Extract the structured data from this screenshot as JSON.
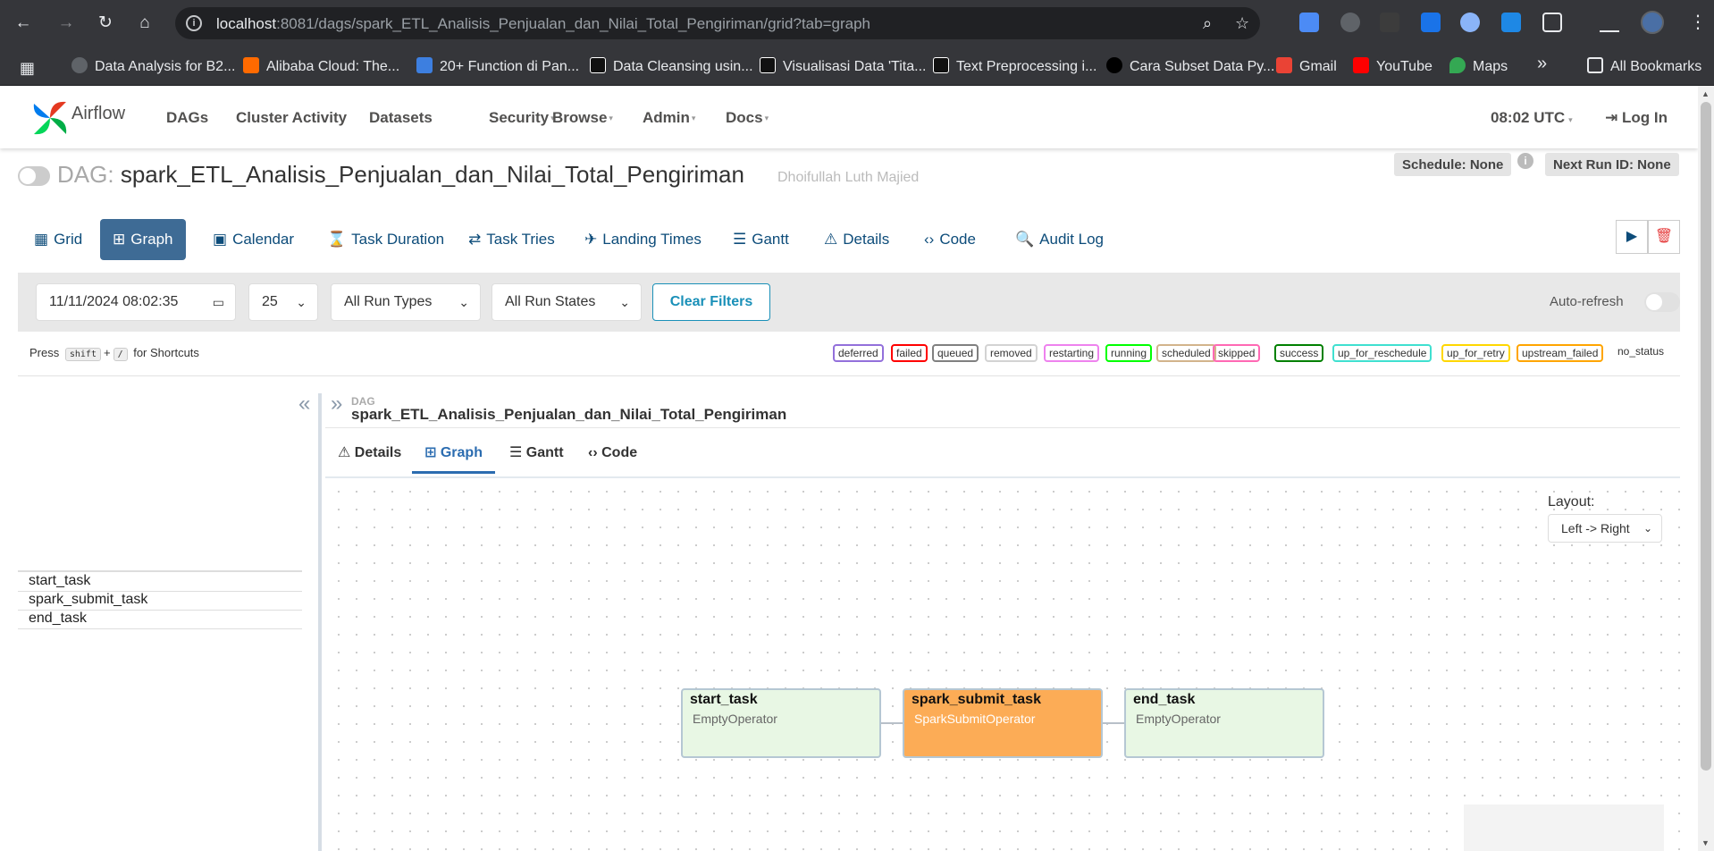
{
  "browser": {
    "url_host": "localhost",
    "url_rest": ":8081/dags/spark_ETL_Analisis_Penjualan_dan_Nilai_Total_Pengiriman/grid?tab=graph",
    "bookmarks": [
      "Data Analysis for B2...",
      "Alibaba Cloud: The...",
      "20+ Function di Pan...",
      "Data Cleansing usin...",
      "Visualisasi Data 'Tita...",
      "Text Preprocessing i...",
      "Cara Subset Data Py...",
      "Gmail",
      "YouTube",
      "Maps"
    ],
    "overflow": "»",
    "all_bookmarks": "All Bookmarks"
  },
  "navbar": {
    "brand": "Airflow",
    "menu": [
      "DAGs",
      "Cluster Activity",
      "Datasets",
      "Security",
      "Browse",
      "Admin",
      "Docs"
    ],
    "time": "08:02 UTC",
    "login": "Log In"
  },
  "dag": {
    "label": "DAG:",
    "id": "spark_ETL_Analisis_Penjualan_dan_Nilai_Total_Pengiriman",
    "owner": "Dhoifullah Luth Majied",
    "schedule": "Schedule: None",
    "next_run": "Next Run ID: None"
  },
  "view_tabs": [
    "Grid",
    "Graph",
    "Calendar",
    "Task Duration",
    "Task Tries",
    "Landing Times",
    "Gantt",
    "Details",
    "Code",
    "Audit Log"
  ],
  "filters": {
    "datetime": "11/11/2024 08:02:35",
    "num_runs": "25",
    "run_types": "All Run Types",
    "run_states": "All Run States",
    "clear": "Clear Filters",
    "auto_refresh": "Auto-refresh"
  },
  "shortcut": {
    "press": "Press",
    "key1": "shift",
    "plus": "+",
    "key2": "/",
    "suffix": "for Shortcuts"
  },
  "legend": [
    {
      "label": "deferred",
      "color": "#9370db"
    },
    {
      "label": "failed",
      "color": "#ff0000"
    },
    {
      "label": "queued",
      "color": "#808080"
    },
    {
      "label": "removed",
      "color": "#d3d3d3"
    },
    {
      "label": "restarting",
      "color": "#ee82ee"
    },
    {
      "label": "running",
      "color": "#00ff00"
    },
    {
      "label": "scheduled",
      "color": "#d2b48c"
    },
    {
      "label": "skipped",
      "color": "#ff69b4"
    },
    {
      "label": "success",
      "color": "#008000"
    },
    {
      "label": "up_for_reschedule",
      "color": "#40e0d0"
    },
    {
      "label": "up_for_retry",
      "color": "#ffd700"
    },
    {
      "label": "upstream_failed",
      "color": "#ffa500"
    },
    {
      "label": "no_status",
      "color": "#ffffff"
    }
  ],
  "tasks": [
    "start_task",
    "spark_submit_task",
    "end_task"
  ],
  "panel": {
    "label": "DAG",
    "name": "spark_ETL_Analisis_Penjualan_dan_Nilai_Total_Pengiriman",
    "tabs": [
      "Details",
      "Graph",
      "Gantt",
      "Code"
    ]
  },
  "graph": {
    "layout_label": "Layout:",
    "layout_value": "Left -> Right",
    "nodes": [
      {
        "name": "start_task",
        "operator": "EmptyOperator"
      },
      {
        "name": "spark_submit_task",
        "operator": "SparkSubmitOperator"
      },
      {
        "name": "end_task",
        "operator": "EmptyOperator"
      }
    ]
  }
}
